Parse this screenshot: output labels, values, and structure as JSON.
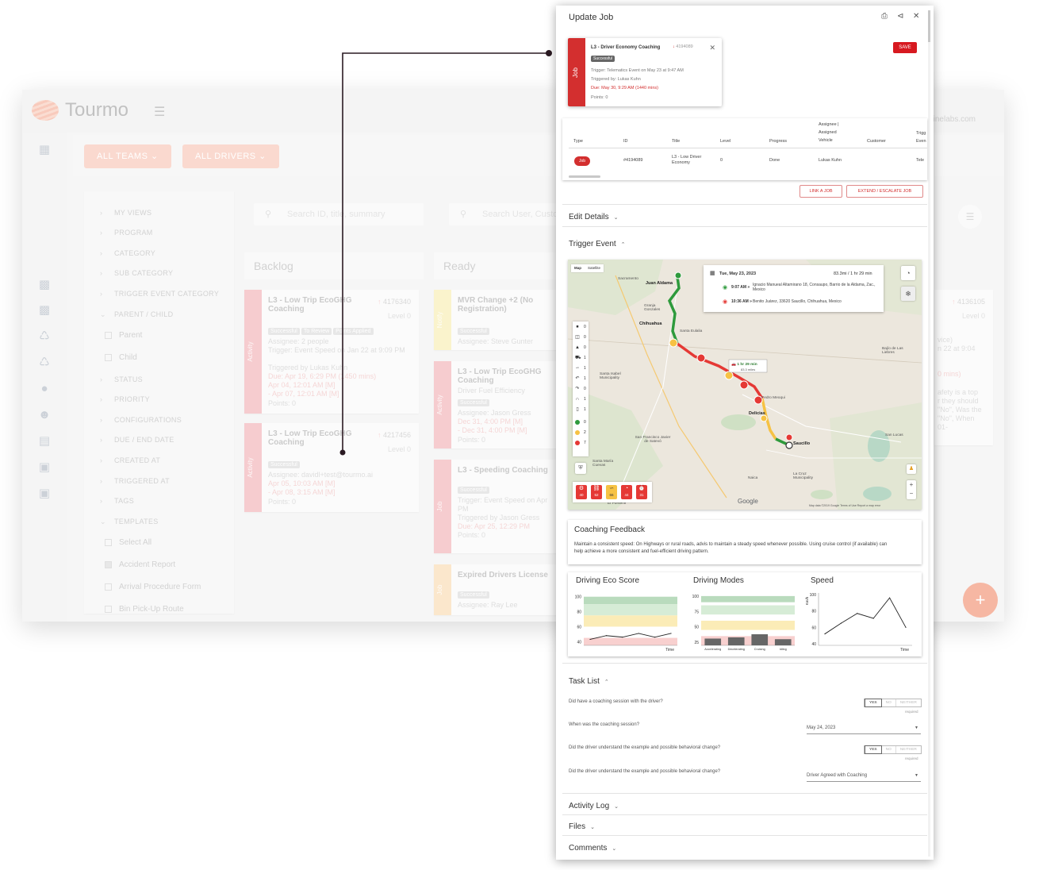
{
  "background": {
    "app_name": "Tourmo",
    "email_fragment": "dlinelabs.com",
    "filters": [
      "ALL TEAMS",
      "ALL DRIVERS"
    ],
    "sidebar": {
      "items": [
        {
          "label": "MY VIEWS"
        },
        {
          "label": "PROGRAM"
        },
        {
          "label": "CATEGORY"
        },
        {
          "label": "SUB CATEGORY"
        },
        {
          "label": "TRIGGER EVENT CATEGORY"
        },
        {
          "label": "PARENT / CHILD"
        },
        {
          "label": "STATUS"
        },
        {
          "label": "PRIORITY"
        },
        {
          "label": "CONFIGURATIONS"
        },
        {
          "label": "DUE / END DATE"
        },
        {
          "label": "CREATED AT"
        },
        {
          "label": "TRIGGERED AT"
        },
        {
          "label": "TAGS"
        },
        {
          "label": "TEMPLATES"
        }
      ],
      "parent_child_options": [
        "Parent",
        "Child"
      ],
      "template_options": [
        "Select All",
        "Accident Report",
        "Arrival Procedure Form",
        "Bin Pick-Up Route"
      ]
    },
    "search": {
      "placeholder_id": "Search ID, title, summary",
      "placeholder_user": "Search User, Custo"
    },
    "columns": [
      "Backlog",
      "Ready"
    ],
    "backlog_cards": [
      {
        "strip": "Activity",
        "title": "L3 - Low Trip EcoGHG Coaching",
        "id": "4176340",
        "level": "Level 0",
        "chips": [
          "Successful",
          "To Review",
          "Points Applied"
        ],
        "lines": [
          "Assignee: 2 people",
          "Trigger: Event Speed on Jan 22 at 9:09 PM",
          "Triggered by Lukas Kuhn"
        ],
        "red_lines": [
          "Due: Apr 19, 6:29 PM (1450 mins)",
          "Apr 04, 12:01 AM [M]",
          "- Apr 07, 12:01 AM [M]"
        ],
        "points": "Points: 0"
      },
      {
        "strip": "Activity",
        "title": "L3 - Low Trip EcoGHG Coaching",
        "id": "4217456",
        "level": "Level 0",
        "chips": [
          "Successful"
        ],
        "lines": [
          "Assignee: davidl+test@tourmo.ai"
        ],
        "red_lines": [
          "Apr 05, 10:03 AM [M]",
          "- Apr 08, 3:15 AM [M]"
        ],
        "points": "Points: 0"
      }
    ],
    "ready_cards": [
      {
        "strip": "Notify",
        "title": "MVR Change +2 (No Registration)",
        "chips": [
          "Successful"
        ],
        "lines": [
          "Assignee: Steve Gunter"
        ],
        "red_lines": [],
        "points": ""
      },
      {
        "strip": "Activity",
        "title": "L3 - Low Trip EcoGHG Coaching",
        "chips": [
          "Successful"
        ],
        "lines": [
          "Driver Fuel Efficiency",
          "Assignee: Jason Gress"
        ],
        "red_lines": [
          "Dec 31, 4:00 PM [M]",
          "- Dec 31, 4:00 PM [M]"
        ],
        "points": "Points: 0"
      },
      {
        "strip": "Job",
        "title": "L3 - Speeding Coaching",
        "chips": [
          "Successful"
        ],
        "lines": [
          "Trigger: Event Speed on Apr",
          "PM",
          "Triggered by Jason Gress"
        ],
        "red_lines": [
          "Due: Apr 25, 12:29 PM"
        ],
        "points": "Points: 0"
      },
      {
        "strip": "Job",
        "title": "Expired Drivers License",
        "chips": [
          "Successful"
        ],
        "lines": [
          "Assignee: Ray Lee"
        ],
        "red_lines": [],
        "points": ""
      }
    ],
    "far_card": {
      "id": "4136105",
      "level": "Level 0",
      "lines": [
        "vice)",
        "n 22 at 9:04",
        "",
        "0 mins)",
        "",
        "afety is a top",
        "r they should",
        "\"No\", Was the",
        "\"No\", When",
        "01-"
      ]
    },
    "fab_label": "+"
  },
  "panel": {
    "title": "Update Job",
    "icons": [
      "print-icon",
      "share-icon",
      "close-icon"
    ],
    "job": {
      "strip_label": "Job",
      "title": "L3 - Driver Economy Coaching",
      "id": "4194089",
      "status": "Successful",
      "trigger": "Trigger: Telematics Event on May 23 at 9:47 AM",
      "triggered_by": "Triggered by: Lukas Kuhn",
      "due": "Due: May 30, 9:29 AM (1440 mins)",
      "points": "Points: 0"
    },
    "save_label": "SAVE",
    "table": {
      "headers": [
        "Type",
        "ID",
        "Title",
        "Level",
        "Progress",
        "Assignee | Assigned Vehicle",
        "Customer",
        "Trigg Even"
      ],
      "row": {
        "type": "Job",
        "id": "#4194089",
        "title": "L3 - Low Driver Economy",
        "level": "0",
        "progress": "Done",
        "assignee": "Lukas Kuhn",
        "customer": "",
        "trigger": "Tele"
      }
    },
    "link_job_label": "LINK A JOB",
    "extend_label": "EXTEND / ESCALATE JOB",
    "sections": {
      "edit_details": "Edit Details",
      "trigger_event": "Trigger Event",
      "task_list": "Task List",
      "activity_log": "Activity Log",
      "files": "Files",
      "comments": "Comments"
    },
    "map": {
      "tabs": [
        "Map",
        "Satellite"
      ],
      "popup": {
        "date": "Tue, May 23, 2023",
        "distance_duration": "83.3mi / 1 hr 29 min",
        "start_time": "9:07 AM",
        "start_address": "Ignacio Manueal Altamirano 18, Consaupo, Barrio de la Aldama, Zac., Mexico",
        "end_time": "10:36 AM",
        "end_address": "Benito Juárez, 33620 Saucillo, Chihuahua, Mexico"
      },
      "route_label": "1 hr 29 min",
      "route_sublabel": "83.3 miles",
      "cities": [
        "Juan Aldama",
        "Chihuahua",
        "Delicias",
        "Saucillo",
        "Sacramento",
        "Granja Gonzales",
        "Santa Eulalia",
        "Santa Isabel Municipality",
        "Pedro Meoqui",
        "San Francisco Javier de Satevó",
        "Santa María Cuevas",
        "Naica",
        "La Cruz Municipality",
        "San Lucas",
        "Bajío de Las Liebres",
        "El Porvenir"
      ],
      "legend": [
        {
          "icon": "camera-icon",
          "count": "0"
        },
        {
          "icon": "trash-icon",
          "count": "0"
        },
        {
          "icon": "warning-icon",
          "count": "0"
        },
        {
          "icon": "truck-icon",
          "count": "1"
        },
        {
          "icon": "swerve-icon",
          "count": "1"
        },
        {
          "icon": "turn-left-icon",
          "count": "1"
        },
        {
          "icon": "turn-right-icon",
          "count": "0"
        },
        {
          "icon": "u-turn-icon",
          "count": "1"
        },
        {
          "icon": "phone-icon",
          "count": "1"
        },
        {
          "icon": "green-dot-icon",
          "count": "0"
        },
        {
          "icon": "yellow-dot-icon",
          "count": "2"
        },
        {
          "icon": "red-dot-icon",
          "count": "7"
        }
      ],
      "events": [
        {
          "icon": "brake-icon",
          "value": "40",
          "color": "#e53935"
        },
        {
          "icon": "seatbelt-icon",
          "value": "52",
          "color": "#e53935"
        },
        {
          "icon": "swerve-event-icon",
          "value": "66",
          "color": "#f6c244"
        },
        {
          "icon": "speed-icon",
          "value": "44",
          "color": "#e53935"
        },
        {
          "icon": "alarm-icon",
          "value": "31",
          "color": "#e53935"
        }
      ],
      "google": "Google",
      "footer": "Map data ©2019 Google   Terms of Use   Report a map error"
    },
    "coaching": {
      "title": "Coaching Feedback",
      "text": "Maintain a consistent speed: On Highways or rural roads, advis to maintain a steady speed whenever possible. Using cruise control (if available) can help achieve a more consistent and fuel-efficient driving pattern."
    },
    "tasks": [
      {
        "question": "Did have a coaching session with the driver?",
        "kind": "yn",
        "options": [
          "YES",
          "NO",
          "NEITHER"
        ],
        "selected": "YES",
        "required": "required"
      },
      {
        "question": "When was the coaching session?",
        "kind": "select",
        "value": "May 24, 2023"
      },
      {
        "question": "Did the driver understand the example and possible behavioral change?",
        "kind": "yn",
        "options": [
          "YES",
          "NO",
          "NEITHER"
        ],
        "selected": "YES",
        "required": "required"
      },
      {
        "question": "Did the driver understand the example and possible behavioral change?",
        "kind": "select",
        "value": "Driver Agreed with Coaching"
      }
    ]
  },
  "chart_data": [
    {
      "type": "line",
      "title": "Driving Eco Score",
      "xlabel": "Time",
      "ylabel": "",
      "yticks": [
        40,
        60,
        80,
        100
      ],
      "ylim": [
        35,
        105
      ],
      "bands": [
        {
          "from": 90,
          "to": 100,
          "color": "#b9dbbd"
        },
        {
          "from": 75,
          "to": 90,
          "color": "#d6ecd6"
        },
        {
          "from": 60,
          "to": 75,
          "color": "#fbecb7"
        },
        {
          "from": 35,
          "to": 45,
          "color": "#f8d0cf"
        }
      ],
      "x": [
        0,
        1,
        2,
        3,
        4,
        5
      ],
      "values": [
        43,
        48,
        46,
        51,
        46,
        51
      ]
    },
    {
      "type": "bar",
      "title": "Driving Modes",
      "xlabel": "",
      "ylabel": "",
      "yticks": [
        25,
        50,
        75,
        100
      ],
      "ylim": [
        20,
        105
      ],
      "bands": [
        {
          "from": 90,
          "to": 100,
          "color": "#b9dbbd"
        },
        {
          "from": 70,
          "to": 85,
          "color": "#d6ecd6"
        },
        {
          "from": 45,
          "to": 60,
          "color": "#fbecb7"
        },
        {
          "from": 20,
          "to": 35,
          "color": "#f8d0cf"
        }
      ],
      "categories": [
        "Accelerating",
        "Decelerating",
        "Cruising",
        "Idling"
      ],
      "values": [
        31,
        33,
        38,
        30
      ]
    },
    {
      "type": "line",
      "title": "Speed",
      "xlabel": "Time",
      "ylabel": "Km/h",
      "yticks": [
        40,
        60,
        80,
        100
      ],
      "ylim": [
        38,
        102
      ],
      "bands": [],
      "x": [
        0,
        1,
        2,
        3,
        4,
        5
      ],
      "values": [
        52,
        65,
        77,
        71,
        96,
        60
      ]
    }
  ]
}
